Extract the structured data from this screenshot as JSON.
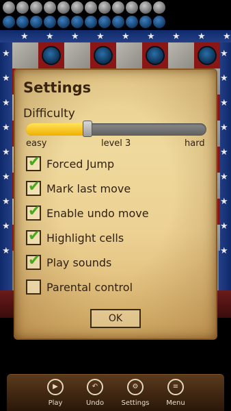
{
  "captured_top": {
    "grey_count": 12,
    "blue_count": 12
  },
  "settings": {
    "title": "Settings",
    "difficulty": {
      "label": "Difficulty",
      "min_label": "easy",
      "value_label": "level 3",
      "max_label": "hard",
      "level_fraction": 0.34
    },
    "options": [
      {
        "label": "Forced Jump",
        "checked": true
      },
      {
        "label": "Mark last move",
        "checked": true
      },
      {
        "label": "Enable undo move",
        "checked": true
      },
      {
        "label": "Highlight cells",
        "checked": true
      },
      {
        "label": "Play sounds",
        "checked": true
      },
      {
        "label": "Parental control",
        "checked": false
      }
    ],
    "ok_label": "OK"
  },
  "toolbar": {
    "items": [
      {
        "label": "Play",
        "icon": "play-icon"
      },
      {
        "label": "Undo",
        "icon": "undo-icon"
      },
      {
        "label": "Settings",
        "icon": "gear-icon"
      },
      {
        "label": "Menu",
        "icon": "menu-icon"
      }
    ]
  },
  "colors": {
    "accent": "#f0b000",
    "check": "#4aa71f",
    "parchment": "#ecd193"
  }
}
